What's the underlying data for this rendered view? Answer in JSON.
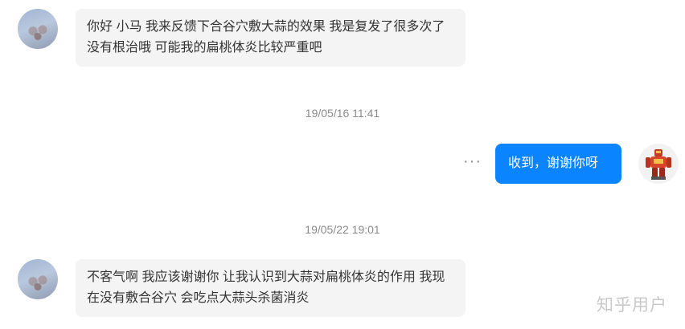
{
  "messages": [
    {
      "from": "other",
      "text": "你好 小马 我来反馈下合谷穴敷大蒜的效果 我是复发了很多次了 没有根治哦 可能我的扁桃体炎比较严重吧"
    },
    {
      "timestamp": "19/05/16 11:41"
    },
    {
      "from": "me",
      "text": "收到，谢谢你呀"
    },
    {
      "timestamp": "19/05/22 19:01"
    },
    {
      "from": "other",
      "text": "不客气啊 我应该谢谢你 让我认识到大蒜对扁桃体炎的作用 我现在没有敷合谷穴 会吃点大蒜头杀菌消炎"
    }
  ],
  "more_icon": "ellipsis-icon",
  "accent_color": "#0a84ff",
  "watermark": "知乎用户"
}
